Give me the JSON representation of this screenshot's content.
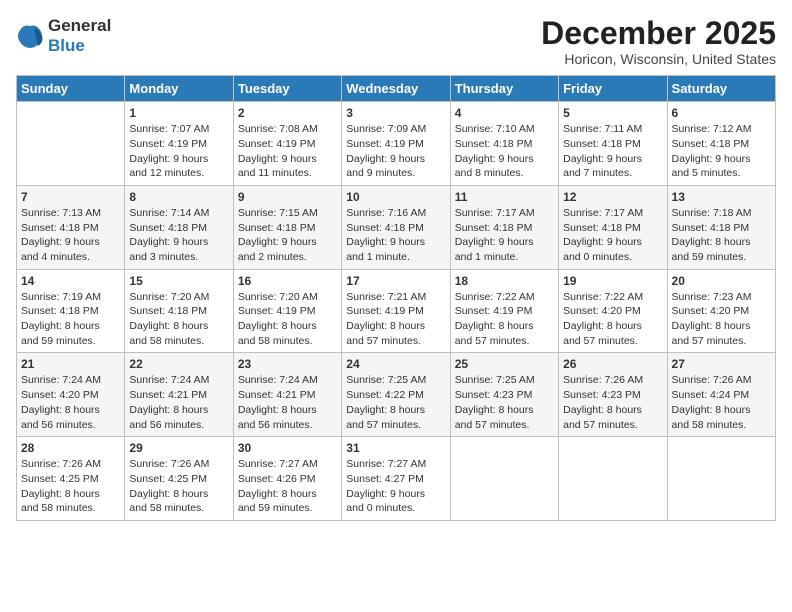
{
  "header": {
    "logo_general": "General",
    "logo_blue": "Blue",
    "month_title": "December 2025",
    "location": "Horicon, Wisconsin, United States"
  },
  "days_of_week": [
    "Sunday",
    "Monday",
    "Tuesday",
    "Wednesday",
    "Thursday",
    "Friday",
    "Saturday"
  ],
  "weeks": [
    [
      {
        "num": "",
        "detail": ""
      },
      {
        "num": "1",
        "detail": "Sunrise: 7:07 AM\nSunset: 4:19 PM\nDaylight: 9 hours\nand 12 minutes."
      },
      {
        "num": "2",
        "detail": "Sunrise: 7:08 AM\nSunset: 4:19 PM\nDaylight: 9 hours\nand 11 minutes."
      },
      {
        "num": "3",
        "detail": "Sunrise: 7:09 AM\nSunset: 4:19 PM\nDaylight: 9 hours\nand 9 minutes."
      },
      {
        "num": "4",
        "detail": "Sunrise: 7:10 AM\nSunset: 4:18 PM\nDaylight: 9 hours\nand 8 minutes."
      },
      {
        "num": "5",
        "detail": "Sunrise: 7:11 AM\nSunset: 4:18 PM\nDaylight: 9 hours\nand 7 minutes."
      },
      {
        "num": "6",
        "detail": "Sunrise: 7:12 AM\nSunset: 4:18 PM\nDaylight: 9 hours\nand 5 minutes."
      }
    ],
    [
      {
        "num": "7",
        "detail": "Sunrise: 7:13 AM\nSunset: 4:18 PM\nDaylight: 9 hours\nand 4 minutes."
      },
      {
        "num": "8",
        "detail": "Sunrise: 7:14 AM\nSunset: 4:18 PM\nDaylight: 9 hours\nand 3 minutes."
      },
      {
        "num": "9",
        "detail": "Sunrise: 7:15 AM\nSunset: 4:18 PM\nDaylight: 9 hours\nand 2 minutes."
      },
      {
        "num": "10",
        "detail": "Sunrise: 7:16 AM\nSunset: 4:18 PM\nDaylight: 9 hours\nand 1 minute."
      },
      {
        "num": "11",
        "detail": "Sunrise: 7:17 AM\nSunset: 4:18 PM\nDaylight: 9 hours\nand 1 minute."
      },
      {
        "num": "12",
        "detail": "Sunrise: 7:17 AM\nSunset: 4:18 PM\nDaylight: 9 hours\nand 0 minutes."
      },
      {
        "num": "13",
        "detail": "Sunrise: 7:18 AM\nSunset: 4:18 PM\nDaylight: 8 hours\nand 59 minutes."
      }
    ],
    [
      {
        "num": "14",
        "detail": "Sunrise: 7:19 AM\nSunset: 4:18 PM\nDaylight: 8 hours\nand 59 minutes."
      },
      {
        "num": "15",
        "detail": "Sunrise: 7:20 AM\nSunset: 4:18 PM\nDaylight: 8 hours\nand 58 minutes."
      },
      {
        "num": "16",
        "detail": "Sunrise: 7:20 AM\nSunset: 4:19 PM\nDaylight: 8 hours\nand 58 minutes."
      },
      {
        "num": "17",
        "detail": "Sunrise: 7:21 AM\nSunset: 4:19 PM\nDaylight: 8 hours\nand 57 minutes."
      },
      {
        "num": "18",
        "detail": "Sunrise: 7:22 AM\nSunset: 4:19 PM\nDaylight: 8 hours\nand 57 minutes."
      },
      {
        "num": "19",
        "detail": "Sunrise: 7:22 AM\nSunset: 4:20 PM\nDaylight: 8 hours\nand 57 minutes."
      },
      {
        "num": "20",
        "detail": "Sunrise: 7:23 AM\nSunset: 4:20 PM\nDaylight: 8 hours\nand 57 minutes."
      }
    ],
    [
      {
        "num": "21",
        "detail": "Sunrise: 7:24 AM\nSunset: 4:20 PM\nDaylight: 8 hours\nand 56 minutes."
      },
      {
        "num": "22",
        "detail": "Sunrise: 7:24 AM\nSunset: 4:21 PM\nDaylight: 8 hours\nand 56 minutes."
      },
      {
        "num": "23",
        "detail": "Sunrise: 7:24 AM\nSunset: 4:21 PM\nDaylight: 8 hours\nand 56 minutes."
      },
      {
        "num": "24",
        "detail": "Sunrise: 7:25 AM\nSunset: 4:22 PM\nDaylight: 8 hours\nand 57 minutes."
      },
      {
        "num": "25",
        "detail": "Sunrise: 7:25 AM\nSunset: 4:23 PM\nDaylight: 8 hours\nand 57 minutes."
      },
      {
        "num": "26",
        "detail": "Sunrise: 7:26 AM\nSunset: 4:23 PM\nDaylight: 8 hours\nand 57 minutes."
      },
      {
        "num": "27",
        "detail": "Sunrise: 7:26 AM\nSunset: 4:24 PM\nDaylight: 8 hours\nand 58 minutes."
      }
    ],
    [
      {
        "num": "28",
        "detail": "Sunrise: 7:26 AM\nSunset: 4:25 PM\nDaylight: 8 hours\nand 58 minutes."
      },
      {
        "num": "29",
        "detail": "Sunrise: 7:26 AM\nSunset: 4:25 PM\nDaylight: 8 hours\nand 58 minutes."
      },
      {
        "num": "30",
        "detail": "Sunrise: 7:27 AM\nSunset: 4:26 PM\nDaylight: 8 hours\nand 59 minutes."
      },
      {
        "num": "31",
        "detail": "Sunrise: 7:27 AM\nSunset: 4:27 PM\nDaylight: 9 hours\nand 0 minutes."
      },
      {
        "num": "",
        "detail": ""
      },
      {
        "num": "",
        "detail": ""
      },
      {
        "num": "",
        "detail": ""
      }
    ]
  ]
}
